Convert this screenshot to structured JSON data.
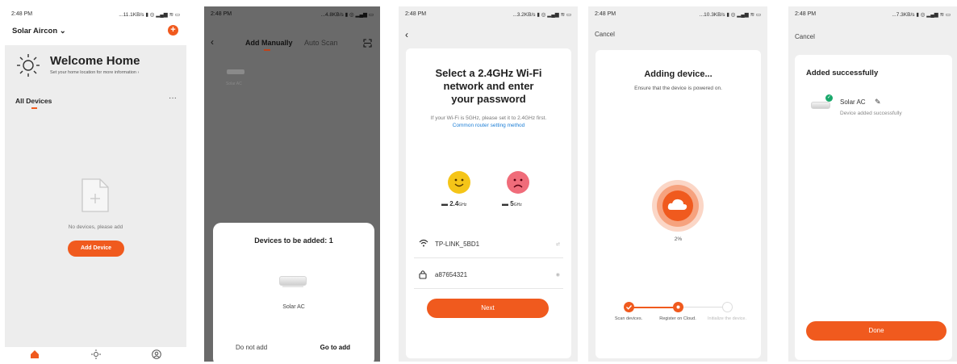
{
  "screens": {
    "home": {
      "time": "2:48 PM",
      "signal": "...11.1KB/s",
      "home_name": "Solar Aircon",
      "welcome_title": "Welcome Home",
      "welcome_sub": "Set your home location for more information",
      "all_devices": "All Devices",
      "no_devices": "No devices, please add",
      "add_device": "Add Device",
      "nav_icons": [
        "home-icon",
        "sun-icon",
        "profile-icon"
      ],
      "accent": "#f05a1e"
    },
    "add_manually": {
      "time": "2:48 PM",
      "signal": "...4.8KB/s",
      "tab_manual": "Add Manually",
      "tab_auto": "Auto Scan",
      "list_device": "Solar AC",
      "sheet_title": "Devices to be added: 1",
      "device_name": "Solar AC",
      "do_not_add": "Do not add",
      "go_to_add": "Go to add"
    },
    "wifi": {
      "time": "2:48 PM",
      "signal": "...3.2KB/s",
      "heading_lines": [
        "Select a 2.4GHz Wi-Fi",
        "network and enter",
        "your password"
      ],
      "hint_text": "If your Wi-Fi is 5GHz, please set it to 2.4GHz first.",
      "hint_link": "Common router setting method",
      "band_good_main": "2.4",
      "band_good_unit": "GHz",
      "band_bad_main": "5",
      "band_bad_unit": "GHz",
      "ssid": "TP-LINK_5BD1",
      "password": "a87654321",
      "next": "Next"
    },
    "adding": {
      "time": "2:48 PM",
      "signal": "...10.3KB/s",
      "cancel": "Cancel",
      "heading": "Adding device...",
      "sub": "Ensure that the device is powered on.",
      "percent": "2%",
      "steps": [
        "Scan devices.",
        "Register on Cloud.",
        "Initialize the device."
      ]
    },
    "success": {
      "time": "2:48 PM",
      "signal": "...7.3KB/s",
      "cancel": "Cancel",
      "heading": "Added successfully",
      "device_name": "Solar AC",
      "status": "Device added successfully",
      "done": "Done"
    }
  }
}
